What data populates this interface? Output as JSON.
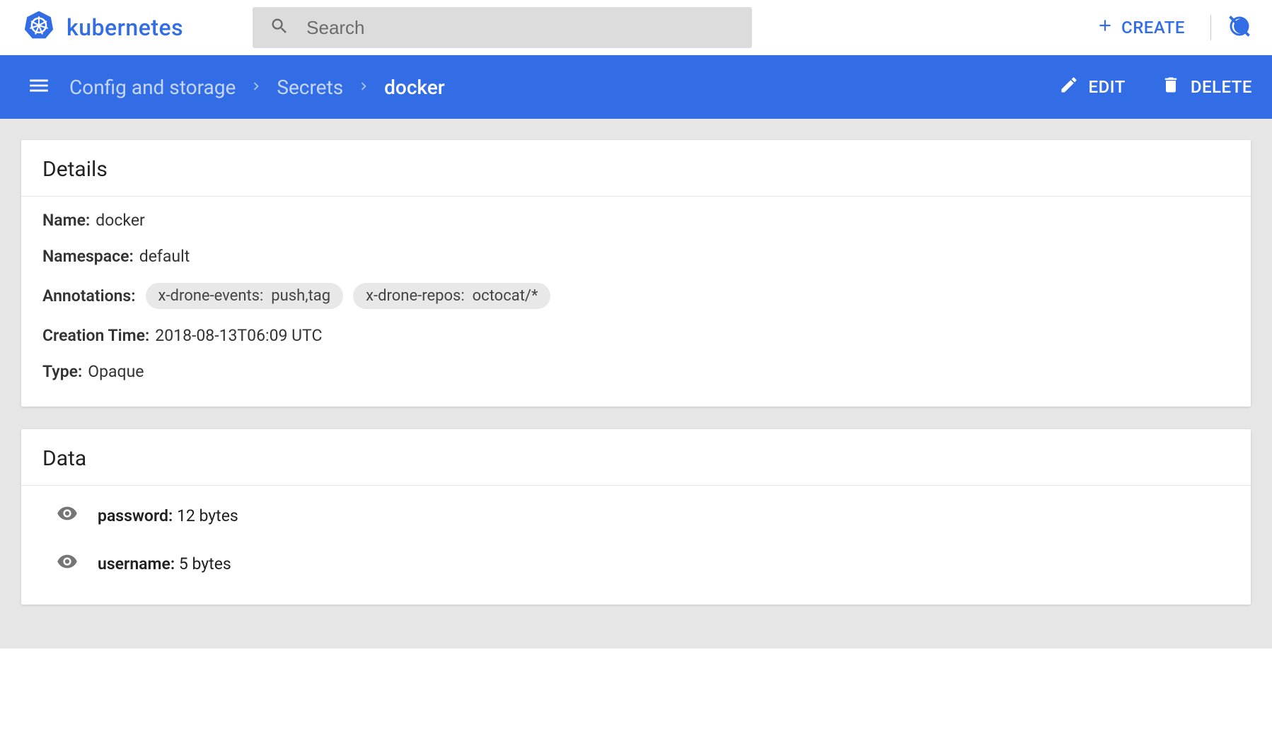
{
  "app": {
    "name": "kubernetes",
    "search_placeholder": "Search",
    "create_label": "CREATE"
  },
  "bluebar": {
    "crumbs": [
      {
        "label": "Config and storage",
        "current": false
      },
      {
        "label": "Secrets",
        "current": false
      },
      {
        "label": "docker",
        "current": true
      }
    ],
    "edit_label": "EDIT",
    "delete_label": "DELETE"
  },
  "details": {
    "title": "Details",
    "fields": {
      "name": {
        "label": "Name",
        "value": "docker"
      },
      "namespace": {
        "label": "Namespace",
        "value": "default"
      },
      "annotations": {
        "label": "Annotations"
      },
      "creation_time": {
        "label": "Creation Time",
        "value": "2018-08-13T06:09 UTC"
      },
      "type": {
        "label": "Type",
        "value": "Opaque"
      }
    },
    "annotations": [
      {
        "key": "x-drone-events",
        "value": "push,tag"
      },
      {
        "key": "x-drone-repos",
        "value": "octocat/*"
      }
    ]
  },
  "data": {
    "title": "Data",
    "items": [
      {
        "key": "password",
        "size": "12 bytes"
      },
      {
        "key": "username",
        "size": "5 bytes"
      }
    ]
  }
}
